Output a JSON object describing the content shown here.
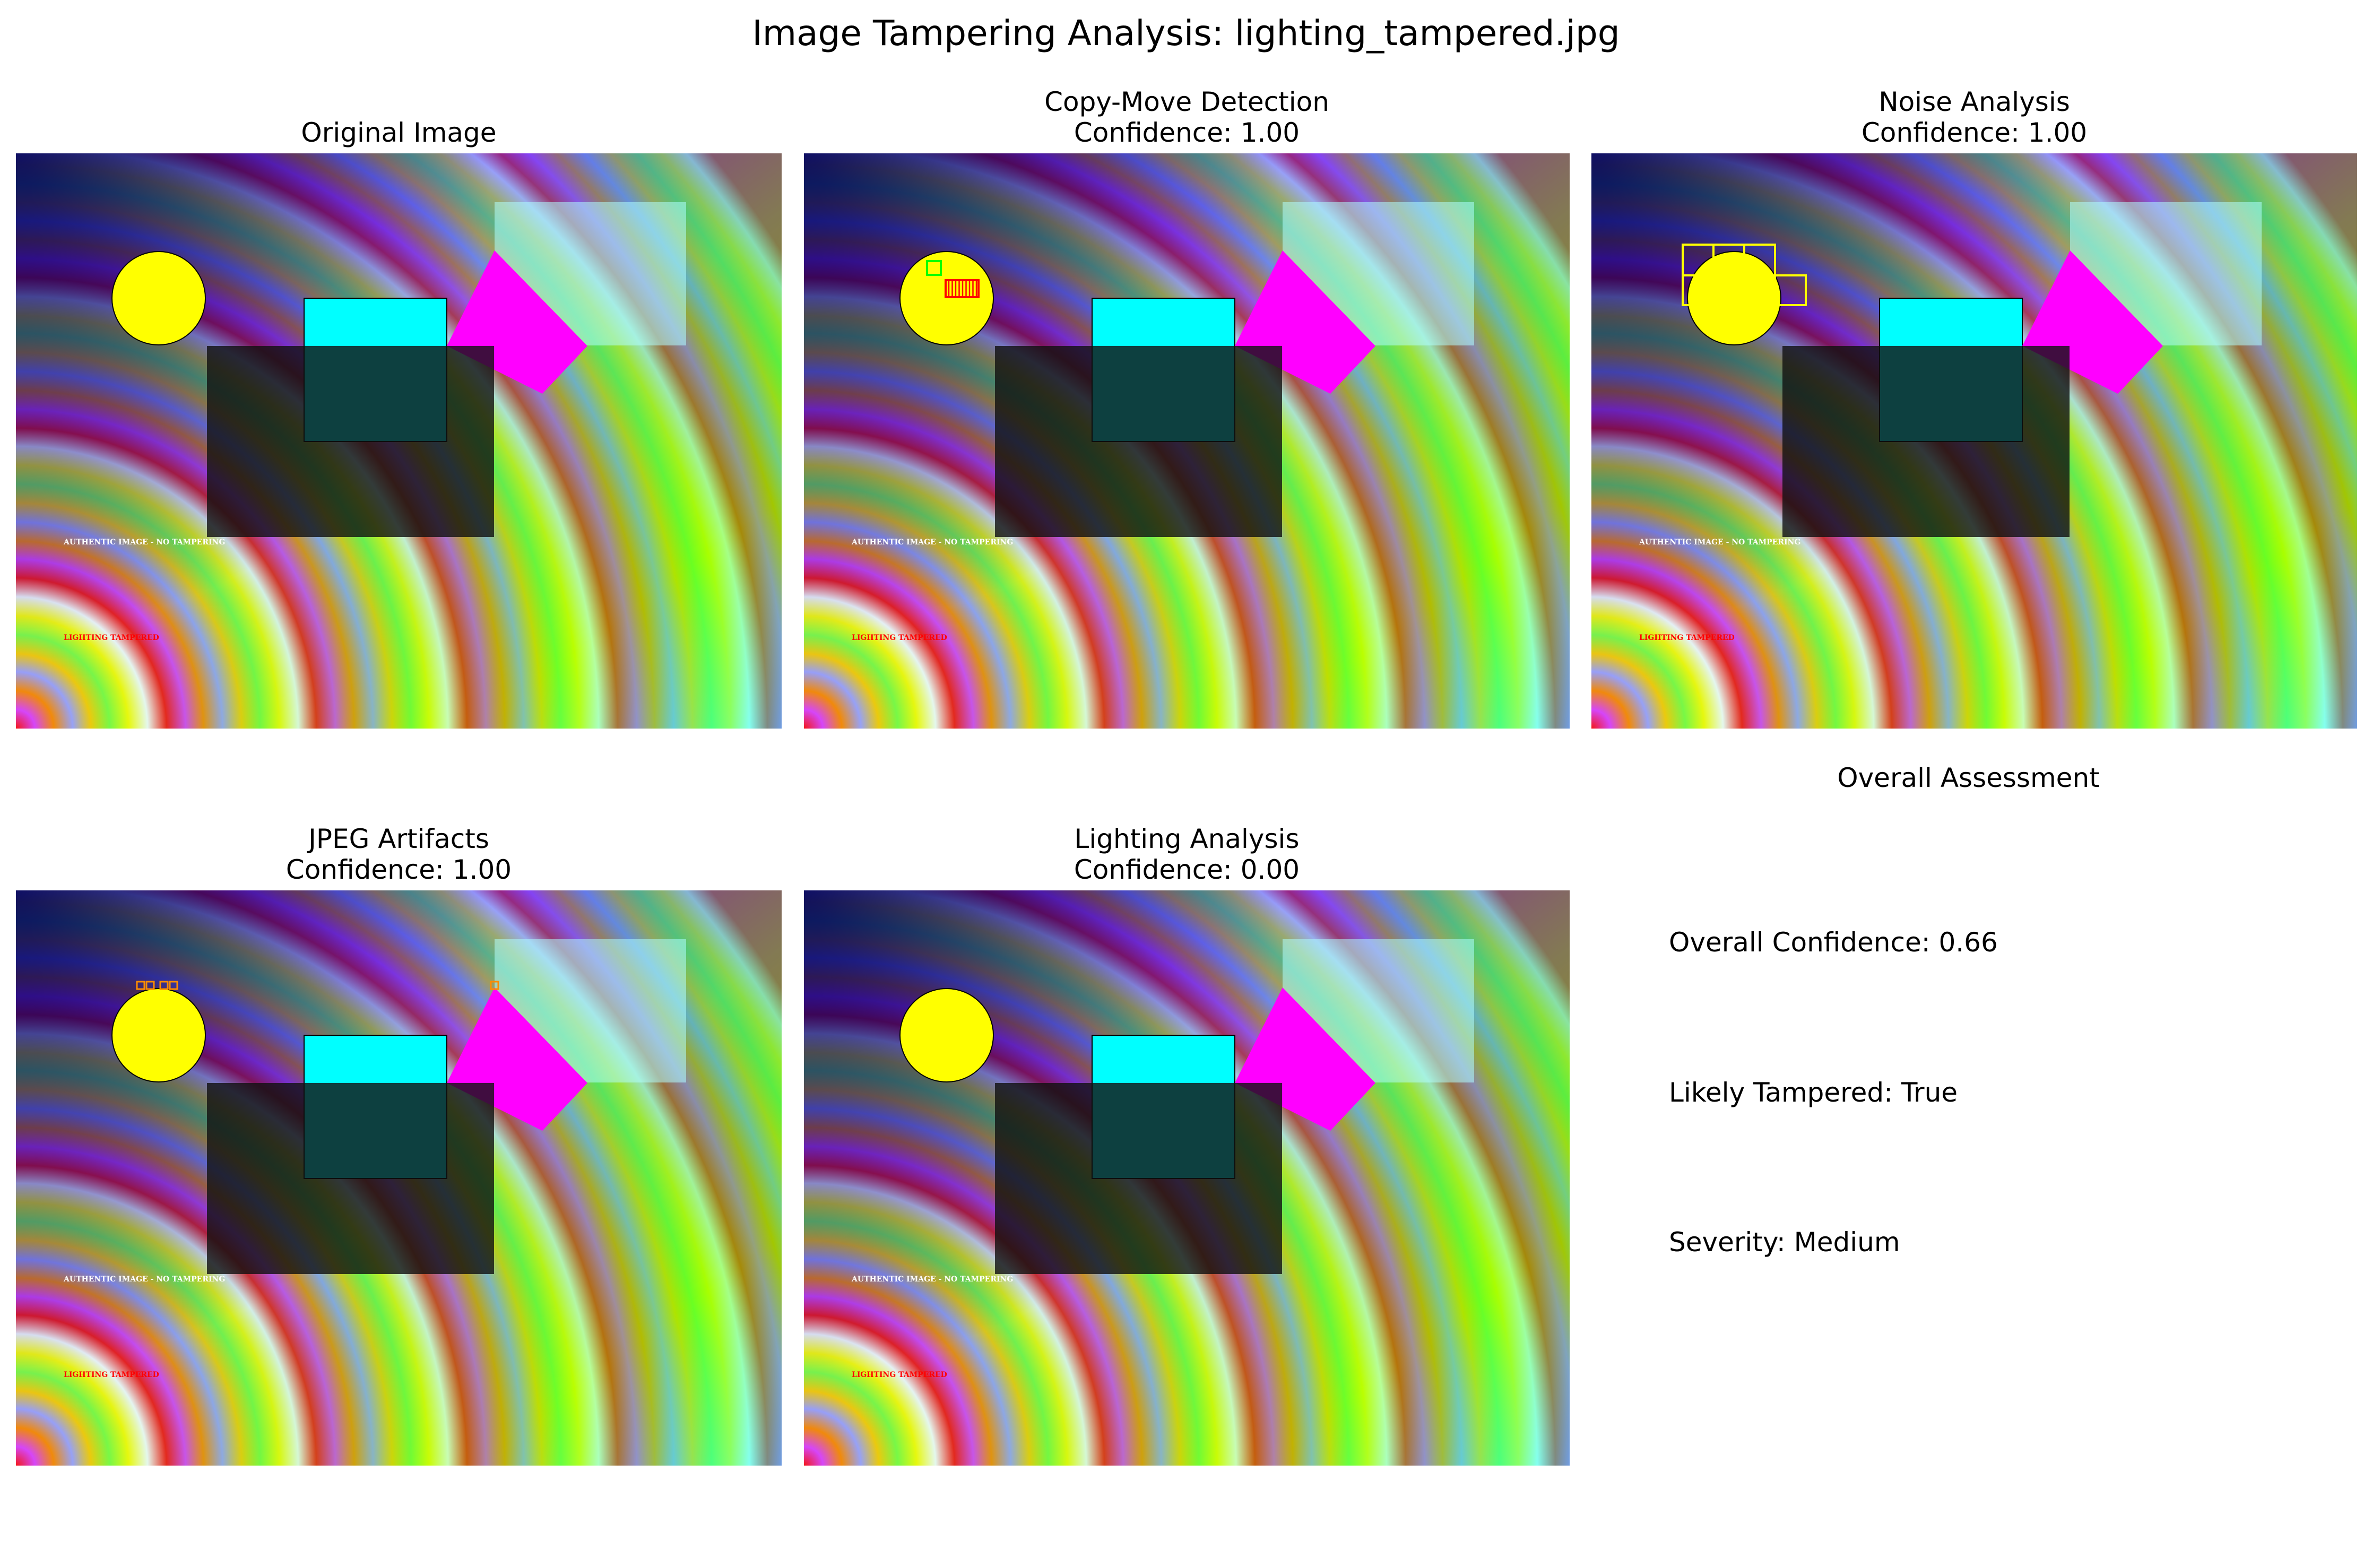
{
  "figure_title": "Image Tampering Analysis: lighting_tampered.jpg",
  "panels": [
    {
      "title": "Original Image",
      "confidence_label": "",
      "markers": "none"
    },
    {
      "title": "Copy-Move Detection",
      "confidence_label": "Confidence: 1.00",
      "markers": "copy-move"
    },
    {
      "title": "Noise Analysis",
      "confidence_label": "Confidence: 1.00",
      "markers": "noise"
    },
    {
      "title": "JPEG Artifacts",
      "confidence_label": "Confidence: 1.00",
      "markers": "jpeg"
    },
    {
      "title": "Lighting Analysis",
      "confidence_label": "Confidence: 0.00",
      "markers": "none"
    }
  ],
  "image_text": {
    "authentic": "AUTHENTIC IMAGE - NO TAMPERING",
    "tampered": "LIGHTING TAMPERED"
  },
  "assessment": {
    "title": "Overall Assessment",
    "confidence": "Overall Confidence: 0.66",
    "likely_tampered": "Likely Tampered: True",
    "severity": "Severity: Medium"
  },
  "colors": {
    "circle": "#ffff00",
    "cyan_square": "#00ffff",
    "magenta_shape": "#ff00ff",
    "copy_move_marker": "#ff0000",
    "copy_move_match": "#00ff00",
    "noise_marker": "#ffff00",
    "jpeg_marker": "#ff8c00"
  }
}
